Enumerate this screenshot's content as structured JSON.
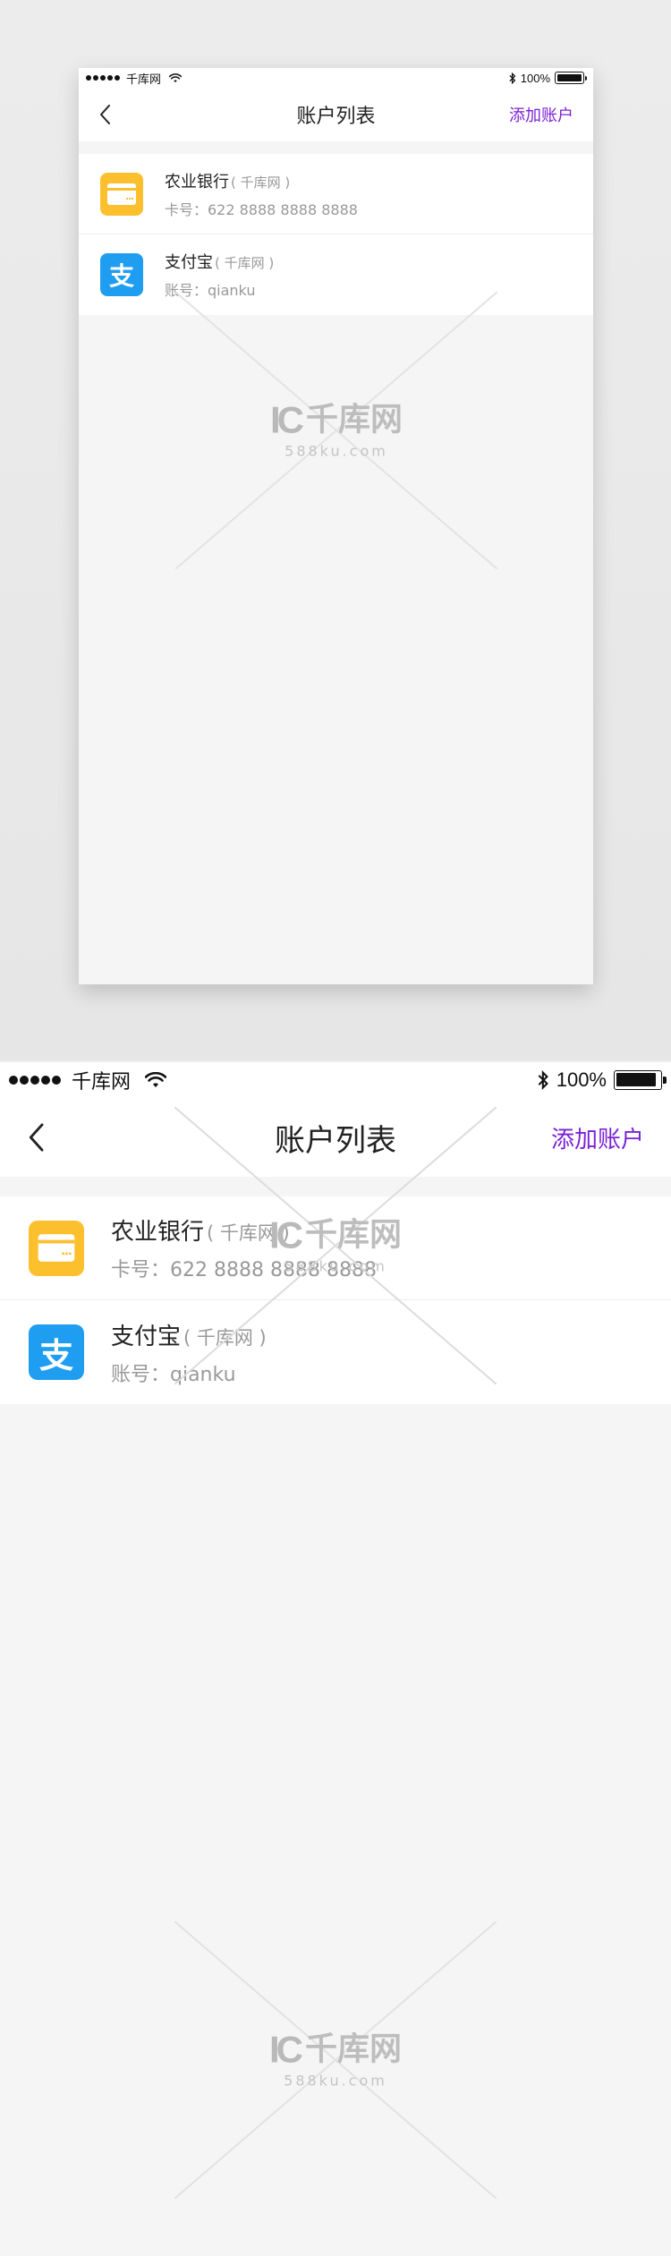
{
  "status_bar": {
    "carrier": "千库网",
    "battery_text": "100%"
  },
  "nav": {
    "title": "账户列表",
    "add_label": "添加账户"
  },
  "accounts": [
    {
      "name": "农业银行",
      "tag": "( 千库网 )",
      "detail": "卡号：622 8888 8888 8888",
      "icon": "bank-card-icon",
      "icon_color": "#fcc02e"
    },
    {
      "name": "支付宝",
      "tag": "( 千库网 )",
      "detail": "账号：qianku",
      "icon": "alipay-icon",
      "icon_glyph": "支",
      "icon_color": "#1f9ef1"
    }
  ],
  "watermark": {
    "brand": "千库网",
    "mark": "IC",
    "domain": "588ku.com"
  },
  "colors": {
    "accent": "#7b22d6",
    "background": "#f5f5f5"
  }
}
